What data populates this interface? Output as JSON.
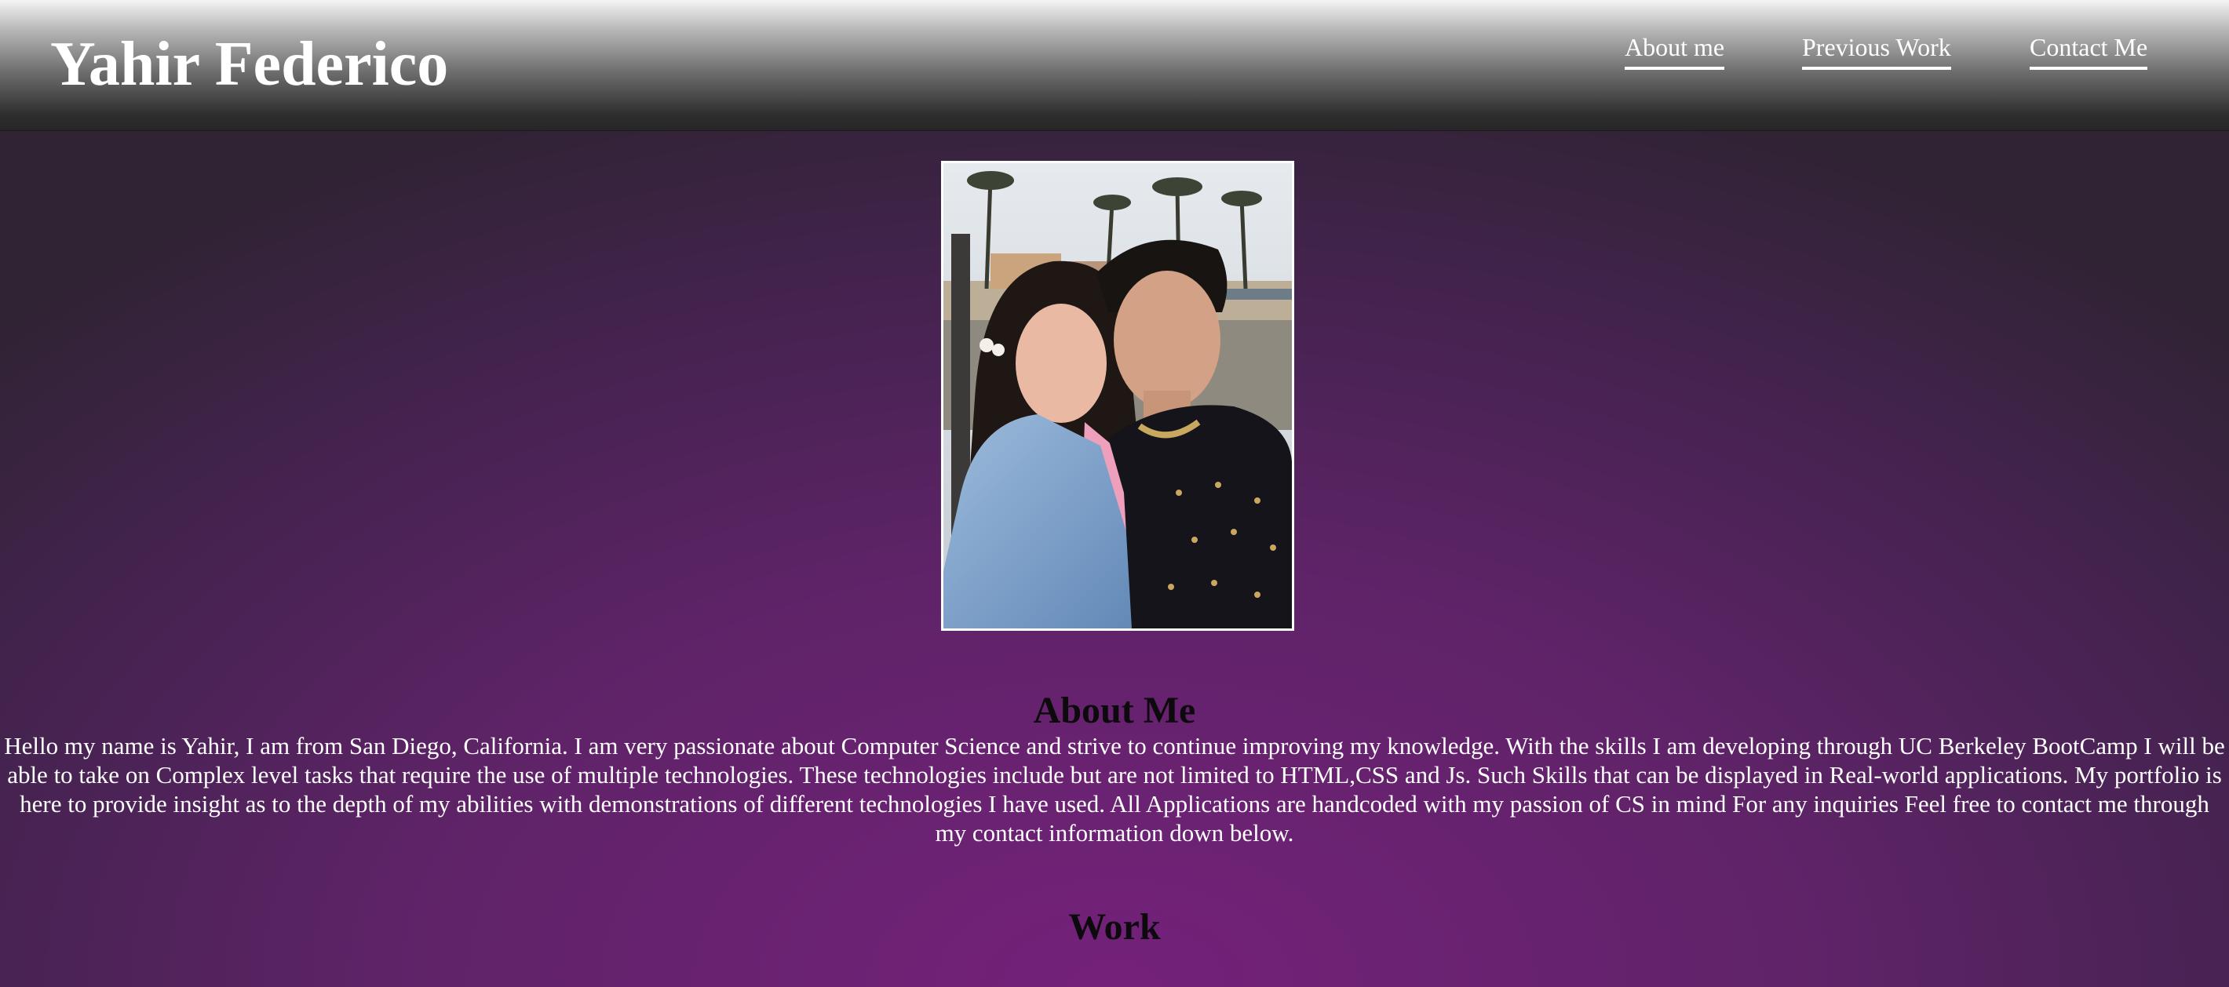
{
  "header": {
    "title": "Yahir Federico",
    "nav": [
      {
        "label": "About me"
      },
      {
        "label": "Previous Work"
      },
      {
        "label": "Contact Me"
      }
    ]
  },
  "about": {
    "heading": "About Me",
    "text": "Hello my name is Yahir, I am from San Diego, California. I am very passionate about Computer Science and strive to continue improving my knowledge. With the skills I am developing through UC Berkeley BootCamp I will be able to take on Complex level tasks that require the use of multiple technologies. These technologies include but are not limited to HTML,CSS and Js. Such Skills that can be displayed in Real-world applications. My portfolio is here to provide insight as to the depth of my abilities with demonstrations of different technologies I have used. All Applications are handcoded with my passion of CS in mind For any inquiries Feel free to contact me through my contact information down below."
  },
  "work": {
    "heading": "Work"
  },
  "colors": {
    "background_center": "#74217a",
    "background_edge": "#302334",
    "header_top": "#f4f4f4",
    "header_bottom": "#262626",
    "heading_text": "#0d0a0e"
  }
}
